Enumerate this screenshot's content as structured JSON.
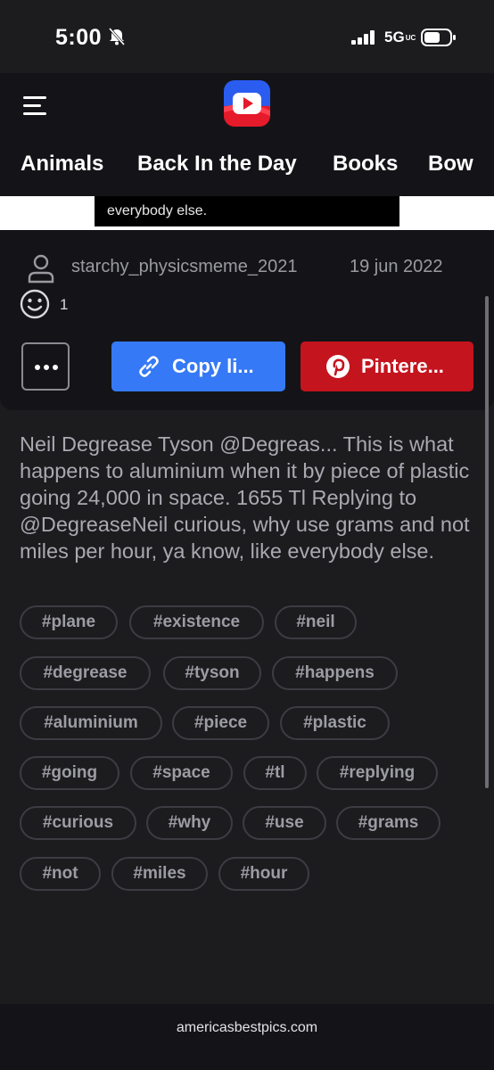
{
  "status_bar": {
    "time": "5:00",
    "network": "5G",
    "network_suffix": "UC"
  },
  "header": {
    "categories": [
      "Animals",
      "Back In the Day",
      "Books",
      "Bow"
    ]
  },
  "image": {
    "visible_text": "everybody else."
  },
  "post": {
    "author": "starchy_physicsmeme_2021",
    "date": "19 jun 2022",
    "reaction_count": "1",
    "more_label": "...",
    "copy_label": "Copy li...",
    "pinterest_label": "Pintere...",
    "description": "Neil Degrease Tyson @Degreas... This is what happens to aluminium when it by piece of plastic going 24,000 in space. 1655 Tl Replying to @DegreaseNeil curious, why use grams and not miles per hour, ya know, like everybody else.",
    "tags": [
      "#plane",
      "#existence",
      "#neil",
      "#degrease",
      "#tyson",
      "#happens",
      "#aluminium",
      "#piece",
      "#plastic",
      "#going",
      "#space",
      "#tl",
      "#replying",
      "#curious",
      "#why",
      "#use",
      "#grams",
      "#not",
      "#miles",
      "#hour"
    ]
  },
  "footer": {
    "url": "americasbestpics.com"
  },
  "colors": {
    "background": "#1c1c1f",
    "header_bg": "#141418",
    "copy_button": "#3579f6",
    "pinterest_button": "#c4141e",
    "muted_text": "#9a9aa2"
  },
  "icons": [
    "bell-slash-icon",
    "signal-icon",
    "battery-icon",
    "menu-icon",
    "app-logo-icon",
    "user-icon",
    "smiley-icon",
    "link-icon",
    "pinterest-icon"
  ]
}
